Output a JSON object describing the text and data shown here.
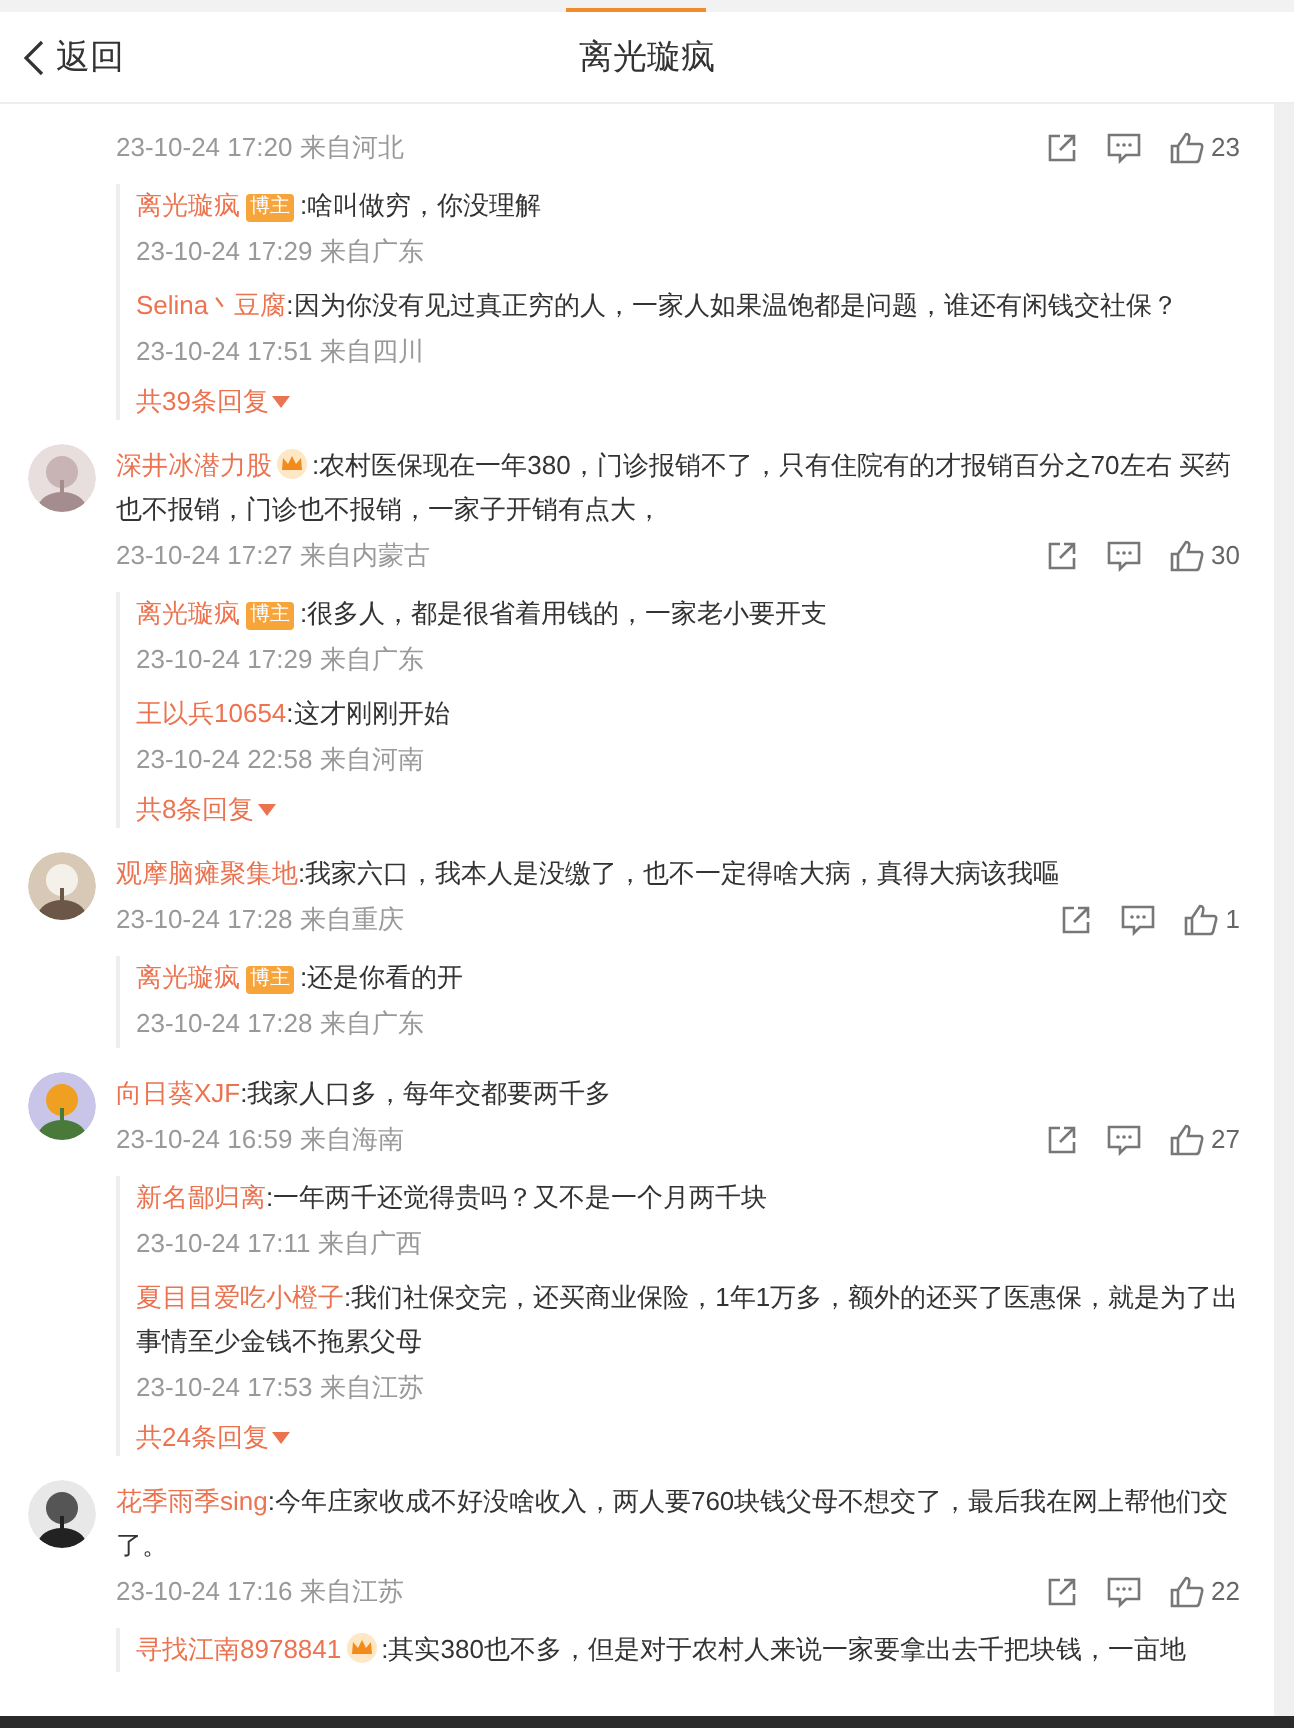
{
  "header": {
    "back": "返回",
    "title": "离光璇疯"
  },
  "comments": [
    {
      "time": "23-10-24 17:20 来自河北",
      "likes": "23",
      "more": "共39条回复",
      "replies": [
        {
          "name": "离光璇疯",
          "badge": {
            "kind": "blogger",
            "text": "博主"
          },
          "text": ":啥叫做穷，你没理解",
          "time": "23-10-24 17:29 来自广东"
        },
        {
          "name": "Selina丶豆腐",
          "text": ":因为你没有见过真正穷的人，一家人如果温饱都是问题，谁还有闲钱交社保？",
          "time": "23-10-24 17:51 来自四川"
        }
      ]
    },
    {
      "avatar": {
        "kind": "picture"
      },
      "name": "深井冰潜力股",
      "badge": {
        "kind": "crown"
      },
      "text": ":农村医保现在一年380，门诊报销不了，只有住院有的才报销百分之70左右 买药也不报销，门诊也不报销，一家子开销有点大，",
      "time": "23-10-24 17:27 来自内蒙古",
      "likes": "30",
      "more": "共8条回复",
      "replies": [
        {
          "name": "离光璇疯",
          "badge": {
            "kind": "blogger",
            "text": "博主"
          },
          "text": ":很多人，都是很省着用钱的，一家老小要开支",
          "time": "23-10-24 17:29 来自广东"
        },
        {
          "name": "王以兵10654",
          "text": ":这才刚刚开始",
          "time": "23-10-24 22:58 来自河南"
        }
      ]
    },
    {
      "avatar": {
        "kind": "picture"
      },
      "name": "观摩脑瘫聚集地",
      "text": ":我家六口，我本人是没缴了，也不一定得啥大病，真得大病该我嘔",
      "time": "23-10-24 17:28 来自重庆",
      "likes": "1",
      "replies": [
        {
          "name": "离光璇疯",
          "badge": {
            "kind": "blogger",
            "text": "博主"
          },
          "text": ":还是你看的开",
          "time": "23-10-24 17:28 来自广东"
        }
      ]
    },
    {
      "avatar": {
        "kind": "picture"
      },
      "name": "向日葵XJF",
      "text": ":我家人口多，每年交都要两千多",
      "time": "23-10-24 16:59 来自海南",
      "likes": "27",
      "more": "共24条回复",
      "replies": [
        {
          "name": "新名鄙归离",
          "text": ":一年两千还觉得贵吗？又不是一个月两千块",
          "time": "23-10-24 17:11 来自广西"
        },
        {
          "name": "夏目目爱吃小橙子",
          "text": ":我们社保交完，还买商业保险，1年1万多，额外的还买了医惠保，就是为了出事情至少金钱不拖累父母",
          "time": "23-10-24 17:53 来自江苏"
        }
      ]
    },
    {
      "avatar": {
        "kind": "picture"
      },
      "name": "花季雨季sing",
      "text": ":今年庄家收成不好没啥收入，两人要760块钱父母不想交了，最后我在网上帮他们交了。",
      "time": "23-10-24 17:16 来自江苏",
      "likes": "22",
      "replies": [
        {
          "name": "寻找江南8978841",
          "badge": {
            "kind": "crown"
          },
          "text": ":其实380也不多，但是对于农村人来说一家要拿出去千把块钱，一亩地"
        }
      ]
    }
  ]
}
